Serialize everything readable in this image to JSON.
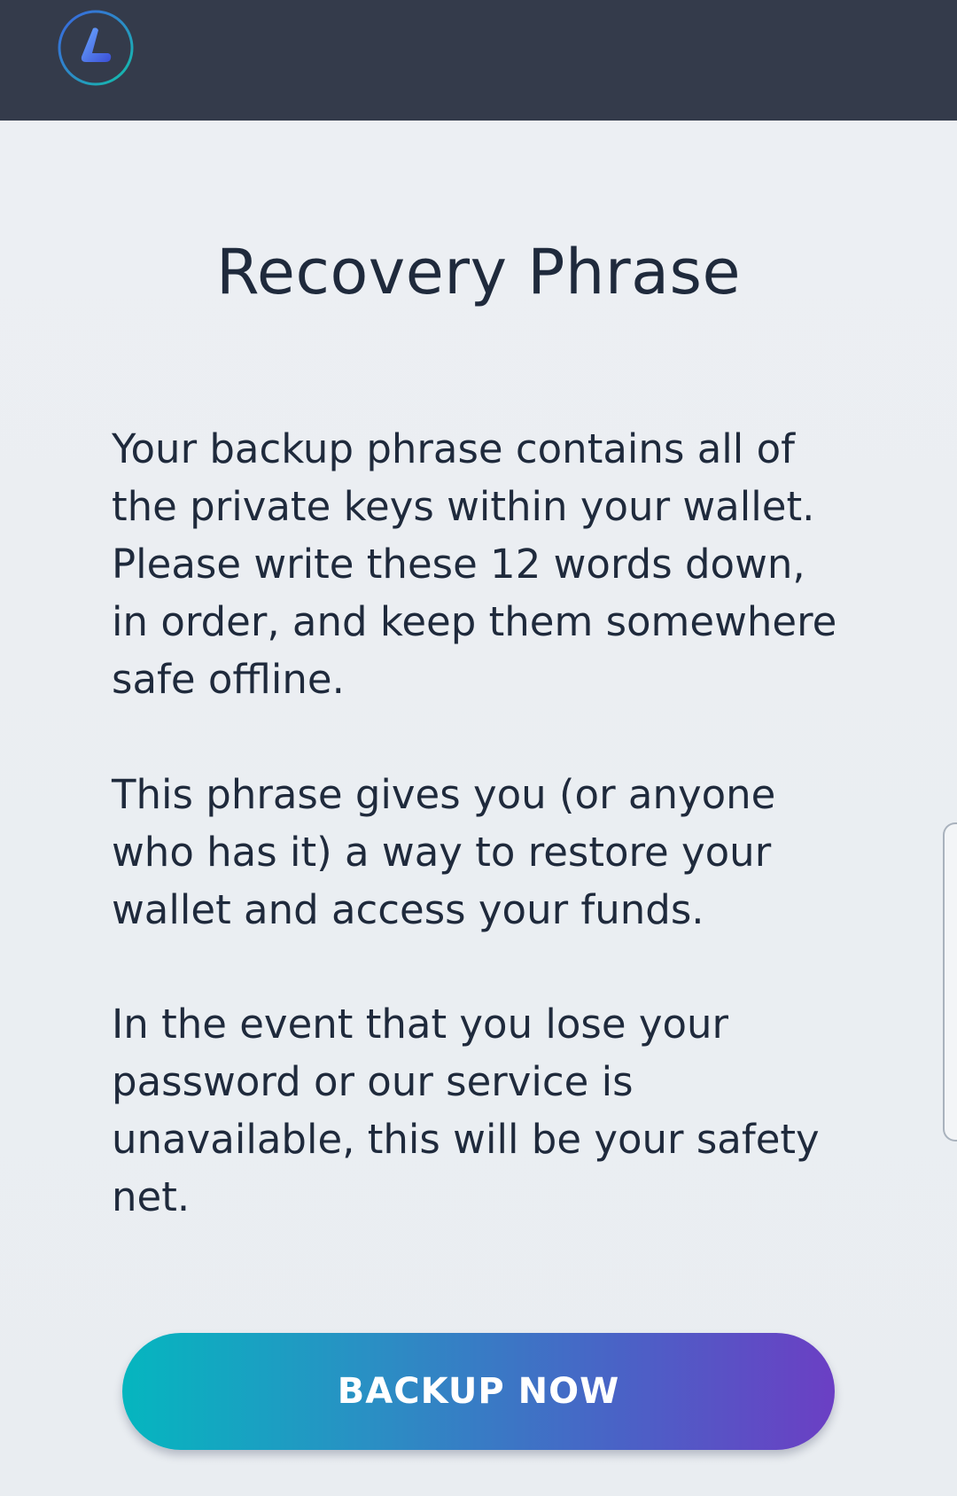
{
  "header": {
    "logo_icon": "wallet-logo-icon"
  },
  "main": {
    "title": "Recovery Phrase",
    "paragraphs": [
      "Your backup phrase contains all of the private keys within your wallet. Please write these 12 words down, in order, and keep them somewhere safe offline.",
      "This phrase gives you (or anyone who has it) a way to restore your wallet and access your funds.",
      "In the event that you lose your password or our service is unavailable, this will be your safety net."
    ],
    "backup_button_label": "BACKUP NOW"
  },
  "colors": {
    "header_bg": "#343b4b",
    "page_bg": "#e9edf1",
    "text": "#1f2a3c",
    "button_gradient_start": "#05b6bf",
    "button_gradient_end": "#6b3fc4"
  }
}
